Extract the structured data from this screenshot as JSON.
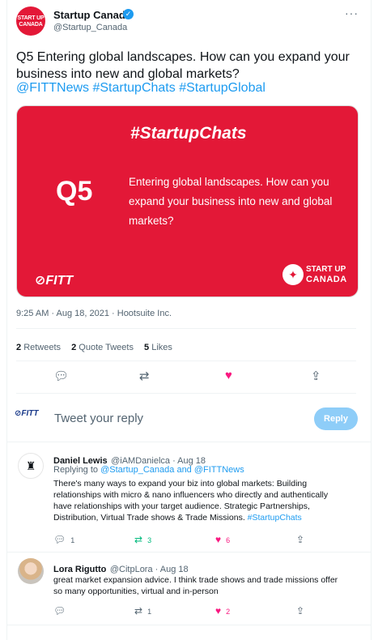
{
  "tweet": {
    "author_name": "Startup Canada",
    "author_handle": "@Startup_Canada",
    "avatar_text": "START UP CANADA",
    "text": "Q5 Entering global landscapes. How can you expand your business into new and global markets?",
    "hashtags": "@FITTNews #StartupChats #StartupGlobal",
    "card": {
      "tag": "#StartupChats",
      "q": "Q5",
      "body": "Entering global landscapes. How can you expand your business into new and global markets?",
      "fitt": "FITT",
      "logo_line1": "START UP",
      "logo_line2": "CANADA"
    },
    "meta": "9:25 AM · Aug 18, 2021 · Hootsuite Inc.",
    "stats": {
      "retweets_count": "2",
      "retweets_label": "Retweets",
      "quotes_count": "2",
      "quotes_label": "Quote Tweets",
      "likes_count": "5",
      "likes_label": "Likes"
    }
  },
  "composer": {
    "avatar_text": "FITT",
    "placeholder": "Tweet your reply",
    "button_label": "Reply"
  },
  "replies": [
    {
      "name": "Daniel Lewis",
      "meta": "@iAMDanielca · Aug 18",
      "replying_prefix": "Replying to",
      "replying_to": "@Startup_Canada and @FITTNews",
      "text": "There's many ways to expand your biz into global markets: Building relationships with micro & nano influencers who directly and authentically have relationships with your target audience. Strategic Partnerships, Distribution, Virtual Trade shows & Trade Missions.",
      "hashtag": "#StartupChats",
      "reply_count": "1",
      "retweet_count": "3",
      "like_count": "6"
    },
    {
      "name": "Lora Rigutto",
      "meta": "@CitpLora · Aug 18",
      "text": "great market expansion advice. I think trade shows and trade missions offer so many opportunities, virtual and in-person",
      "reply_count": "",
      "retweet_count": "1",
      "like_count": "2"
    }
  ],
  "colors": {
    "accent": "#1d9bf0",
    "brand_red": "#e31837",
    "like_red": "#f91880",
    "retweet_green": "#00ba7c"
  },
  "icons": [
    "verified-icon",
    "more-icon",
    "reply-icon",
    "retweet-icon",
    "like-icon",
    "share-icon",
    "maple-leaf-icon"
  ]
}
